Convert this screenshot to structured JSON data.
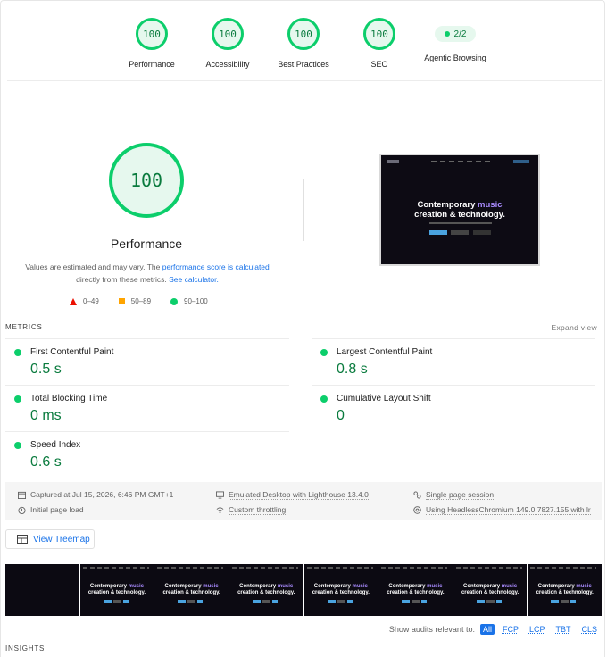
{
  "summary": {
    "gauges": [
      {
        "score": "100",
        "label": "Performance"
      },
      {
        "score": "100",
        "label": "Accessibility"
      },
      {
        "score": "100",
        "label": "Best Practices"
      },
      {
        "score": "100",
        "label": "SEO"
      }
    ],
    "agentic": {
      "value": "2/2",
      "label": "Agentic Browsing"
    }
  },
  "performance": {
    "score": "100",
    "title": "Performance",
    "desc_1": "Values are estimated and may vary. The ",
    "desc_link_1": "performance score is calculated",
    "desc_2": " directly from these metrics. ",
    "desc_link_2": "See calculator.",
    "legend": {
      "fail": "0–49",
      "average": "50–89",
      "pass": "90–100"
    }
  },
  "screenshot": {
    "headline_1": "Contemporary ",
    "headline_accent": "music",
    "headline_2": "creation & technology."
  },
  "metrics": {
    "section_label": "METRICS",
    "expand_label": "Expand view",
    "fcp": {
      "name": "First Contentful Paint",
      "value": "0.5 s"
    },
    "lcp": {
      "name": "Largest Contentful Paint",
      "value": "0.8 s"
    },
    "tbt": {
      "name": "Total Blocking Time",
      "value": "0 ms"
    },
    "cls": {
      "name": "Cumulative Layout Shift",
      "value": "0"
    },
    "si": {
      "name": "Speed Index",
      "value": "0.6 s"
    }
  },
  "runtime": {
    "captured": "Captured at Jul 15, 2026, 6:46 PM GMT+1",
    "initial": "Initial page load",
    "emulated": "Emulated Desktop with Lighthouse 13.4.0",
    "throttling": "Custom throttling",
    "session": "Single page session",
    "browser": "Using HeadlessChromium 149.0.7827.155 with lr"
  },
  "treemap_label": "View Treemap",
  "filter": {
    "label": "Show audits relevant to:",
    "chips": [
      "All",
      "FCP",
      "LCP",
      "TBT",
      "CLS"
    ]
  },
  "insights_label": "INSIGHTS",
  "colors": {
    "pass": "#0cce6b",
    "average": "#ffa400",
    "fail": "#eb0f00",
    "link": "#1a73e8"
  }
}
